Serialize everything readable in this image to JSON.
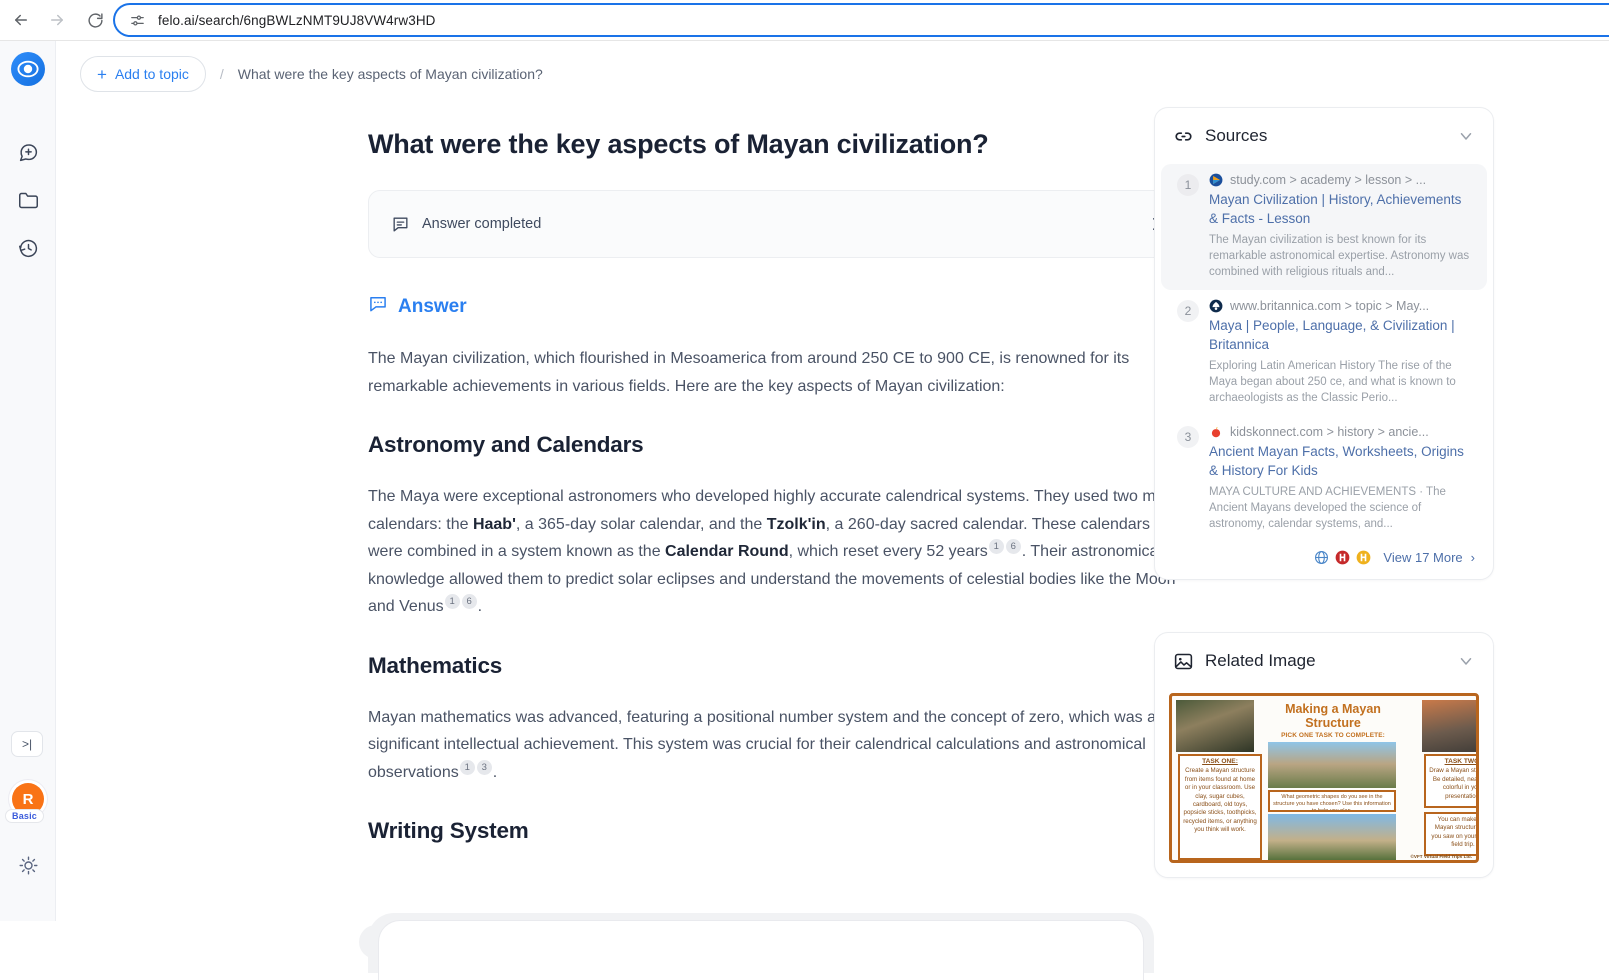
{
  "browser": {
    "back_label": "Back",
    "forward_label": "Forward",
    "reload_label": "Reload",
    "url": "felo.ai/search/6ngBWLzNMT9UJ8VW4rw3HD",
    "accent_color": "#1a73e8"
  },
  "sidebar": {
    "logo_label": "Felo",
    "items": [
      {
        "name": "new-chat",
        "label": "New chat"
      },
      {
        "name": "folder",
        "label": "Collections"
      },
      {
        "name": "history",
        "label": "History"
      }
    ],
    "expand_label": ">|",
    "avatar": {
      "initial": "R",
      "plan": "Basic",
      "color": "#f97316"
    },
    "theme_label": "Theme"
  },
  "topbar": {
    "add_topic_label": "Add to topic",
    "add_topic_plus": "+",
    "separator": "/",
    "breadcrumb_title": "What were the key aspects of Mayan civilization?"
  },
  "main": {
    "question_title": "What were the key aspects of Mayan civilization?",
    "status": {
      "label": "Answer completed",
      "chevron": "›"
    },
    "answer_label": "Answer",
    "intro": "The Mayan civilization, which flourished in Mesoamerica from around 250 CE to 900 CE, is renowned for its remarkable achievements in various fields. Here are the key aspects of Mayan civilization:",
    "sections": [
      {
        "heading": "Astronomy and Calendars",
        "p_a": "The Maya were exceptional astronomers who developed highly accurate calendrical systems. They used two main calendars: the ",
        "b1": "Haab'",
        "p_b": ", a 365-day solar calendar, and the ",
        "b2": "Tzolk'in",
        "p_c": ", a 260-day sacred calendar. These calendars were combined in a system known as the ",
        "b3": "Calendar Round",
        "p_d": ", which reset every 52 years",
        "cites_1": [
          "1",
          "6"
        ],
        "p_e": ". Their astronomical knowledge allowed them to predict solar eclipses and understand the movements of celestial bodies like the Moon and Venus",
        "cites_2": [
          "1",
          "6"
        ],
        "p_f": "."
      },
      {
        "heading": "Mathematics",
        "p_a": "Mayan mathematics was advanced, featuring a positional number system and the concept of zero, which was a significant intellectual achievement. This system was crucial for their calendrical calculations and astronomical observations",
        "cites_1": [
          "1",
          "3"
        ],
        "p_b": "."
      },
      {
        "heading": "Writing System"
      }
    ]
  },
  "right": {
    "sources": {
      "title": "Sources",
      "icon": "link-icon",
      "items": [
        {
          "num": "1",
          "domain": "study.com > academy > lesson > ...",
          "title": "Mayan Civilization | History, Achievements & Facts - Lesson",
          "snippet": "The Mayan civilization is best known for its remarkable astronomical expertise. Astronomy was combined with religious rituals and..."
        },
        {
          "num": "2",
          "domain": "www.britannica.com > topic > May...",
          "title": "Maya | People, Language, & Civilization | Britannica",
          "snippet": "Exploring Latin American History The rise of the Maya began about 250 ce, and what is known to archaeologists as the Classic Perio..."
        },
        {
          "num": "3",
          "domain": "kidskonnect.com > history > ancie...",
          "title": "Ancient Mayan Facts, Worksheets, Origins & History For Kids",
          "snippet": "MAYA CULTURE AND ACHIEVEMENTS · The Ancient Mayans developed the science of astronomy, calendar systems, and..."
        }
      ],
      "view_more_label": "View 17 More",
      "view_more_chevron": "›"
    },
    "related_image": {
      "title": "Related Image",
      "icon": "image-icon",
      "worksheet": {
        "title": "Making a\nMayan Structure",
        "subtitle": "PICK ONE TASK TO COMPLETE:",
        "task_one_head": "TASK ONE:",
        "task_one_body": "Create a Mayan structure from items found at home or in your classroom.\n\nUse clay, sugar cubes, cardboard, old toys, popsicle sticks, toothpicks, recycled items, or anything you think will work.",
        "task_two_head": "TASK TWO:",
        "task_two_body": "Draw a Mayan structure.\nBe detailed, neat, and colorful in your presentation.",
        "note_box": "You can make any Mayan structure that you saw on your virtual field trip.",
        "prompt_box": "What geometric shapes do you see in the structure you have chosen? Use this information to help you plan.",
        "credit": "©VFT Virtual Field Trips Ltd."
      }
    }
  }
}
